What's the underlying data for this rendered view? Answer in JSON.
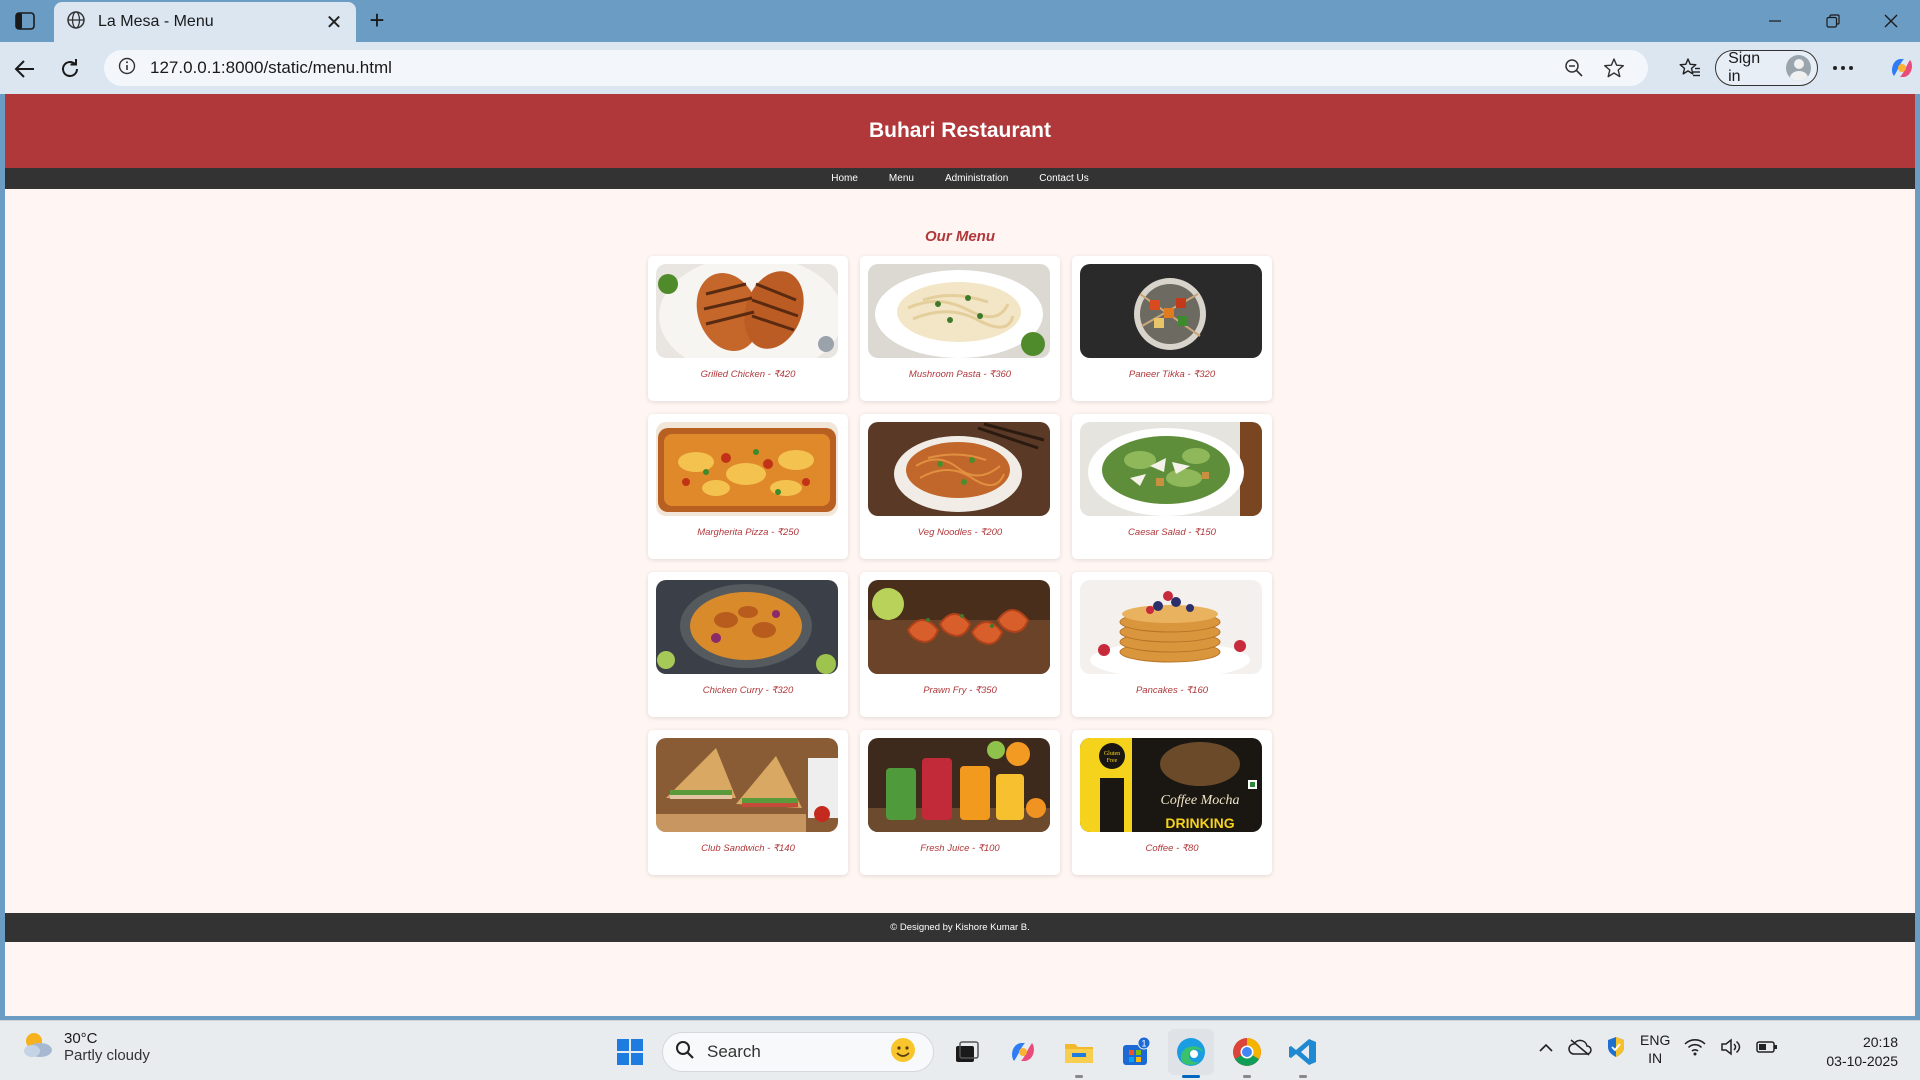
{
  "browser": {
    "tab_title": "La Mesa - Menu",
    "url": "127.0.0.1:8000/static/menu.html",
    "signin_label": "Sign in"
  },
  "page": {
    "title": "Buhari Restaurant",
    "nav": [
      "Home",
      "Menu",
      "Administration",
      "Contact Us"
    ],
    "heading": "Our Menu",
    "items": [
      {
        "caption": "Grilled Chicken - ₹420",
        "image": "grilled-chicken"
      },
      {
        "caption": "Mushroom Pasta - ₹360",
        "image": "mushroom-pasta"
      },
      {
        "caption": "Paneer Tikka - ₹320",
        "image": "paneer-tikka"
      },
      {
        "caption": "Margherita Pizza - ₹250",
        "image": "margherita-pizza"
      },
      {
        "caption": "Veg Noodles - ₹200",
        "image": "veg-noodles"
      },
      {
        "caption": "Caesar Salad - ₹150",
        "image": "caesar-salad"
      },
      {
        "caption": "Chicken Curry - ₹320",
        "image": "chicken-curry"
      },
      {
        "caption": "Prawn Fry - ₹350",
        "image": "prawn-fry"
      },
      {
        "caption": "Pancakes - ₹160",
        "image": "pancakes"
      },
      {
        "caption": "Club Sandwich - ₹140",
        "image": "club-sandwich"
      },
      {
        "caption": "Fresh Juice - ₹100",
        "image": "fresh-juice"
      },
      {
        "caption": "Coffee - ₹80",
        "image": "coffee"
      }
    ],
    "footer": "© Designed by Kishore Kumar B.",
    "coffee_pack": {
      "badge_line1": "Gluten",
      "badge_line2": "Free",
      "brand": "Coffee Mocha",
      "sub": "DRINKING"
    }
  },
  "taskbar": {
    "temperature": "30°C",
    "condition": "Partly cloudy",
    "search_placeholder": "Search",
    "store_badge": "1",
    "lang_line1": "ENG",
    "lang_line2": "IN",
    "time": "20:18",
    "date": "03-10-2025"
  },
  "colors": {
    "header_red": "#b0383b",
    "nav_dark": "#333333",
    "page_bg": "#fff5f2",
    "chrome_blue": "#6b9cc3"
  }
}
